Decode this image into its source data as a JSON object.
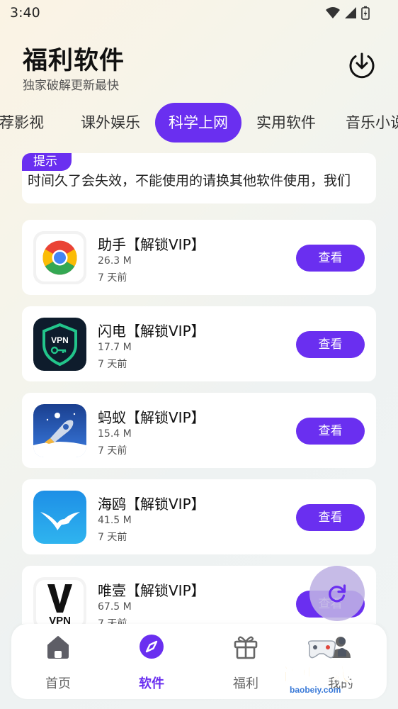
{
  "status_bar": {
    "time": "3:40"
  },
  "header": {
    "title": "福利软件",
    "subtitle": "独家破解更新最快"
  },
  "tabs": [
    {
      "label": "推荐影视"
    },
    {
      "label": "课外娱乐"
    },
    {
      "label": "科学上网",
      "active": true
    },
    {
      "label": "实用软件"
    },
    {
      "label": "音乐小说"
    }
  ],
  "notice": {
    "tag": "提示",
    "text": "时间久了会失效，不能使用的请换其他软件使用，我们"
  },
  "apps": [
    {
      "name": "助手【解锁VIP】",
      "size": "26.3 M",
      "time": "7 天前",
      "button": "查看",
      "icon": "chrome-style-icon"
    },
    {
      "name": "闪电【解锁VIP】",
      "size": "17.7 M",
      "time": "7 天前",
      "button": "查看",
      "icon": "vpn-shield-icon"
    },
    {
      "name": "蚂蚁【解锁VIP】",
      "size": "15.4 M",
      "time": "7 天前",
      "button": "查看",
      "icon": "rocket-ant-icon"
    },
    {
      "name": "海鸥【解锁VIP】",
      "size": "41.5 M",
      "time": "7 天前",
      "button": "查看",
      "icon": "seagull-icon"
    },
    {
      "name": "唯壹【解锁VIP】",
      "size": "67.5 M",
      "time": "7 天前",
      "button": "查看",
      "icon": "v-vpn-icon"
    }
  ],
  "bottom_nav": [
    {
      "label": "首页",
      "icon": "home-icon"
    },
    {
      "label": "软件",
      "icon": "compass-icon",
      "active": true
    },
    {
      "label": "福利",
      "icon": "gift-icon"
    },
    {
      "label": "我的",
      "icon": "user-icon"
    }
  ],
  "watermark": {
    "text": "宝贝游戏网",
    "url": "baobeiy.com"
  },
  "colors": {
    "accent": "#6a2ff0",
    "card": "#ffffff",
    "fab": "#beb2e4"
  }
}
